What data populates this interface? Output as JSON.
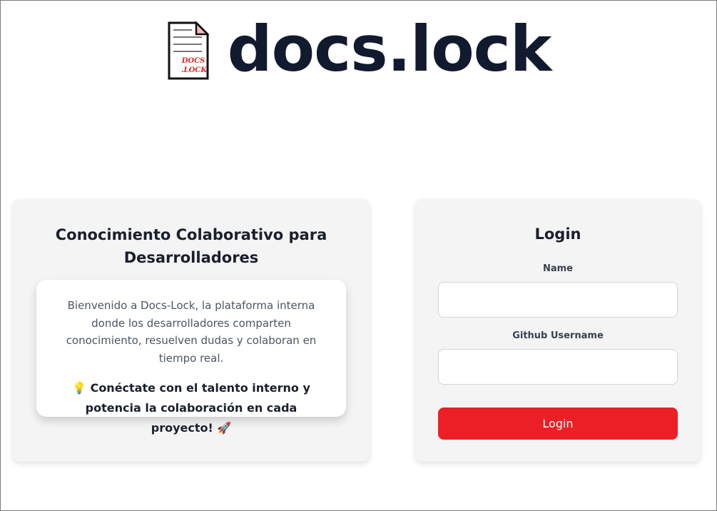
{
  "header": {
    "logo_text_line1": "DOCS",
    "logo_text_line2": ".LOCK",
    "brand": "docs.lock"
  },
  "info_card": {
    "title": "Conocimiento Colaborativo para Desarrolladores",
    "intro": "Bienvenido a Docs-Lock, la plataforma interna donde los desarrolladores comparten conocimiento, resuelven dudas y colaboran en tiempo real.",
    "cta": "💡 Conéctate con el talento interno y potencia la colaboración en cada proyecto! 🚀"
  },
  "login_card": {
    "title": "Login",
    "name_label": "Name",
    "name_value": "",
    "github_label": "Github Username",
    "github_value": "",
    "button_label": "Login"
  },
  "colors": {
    "brand_text": "#111a2e",
    "button": "#ec1f27",
    "card_bg": "#f4f4f4",
    "logo_accent": "#dc2626"
  },
  "icons": {
    "logo": "document-icon"
  }
}
